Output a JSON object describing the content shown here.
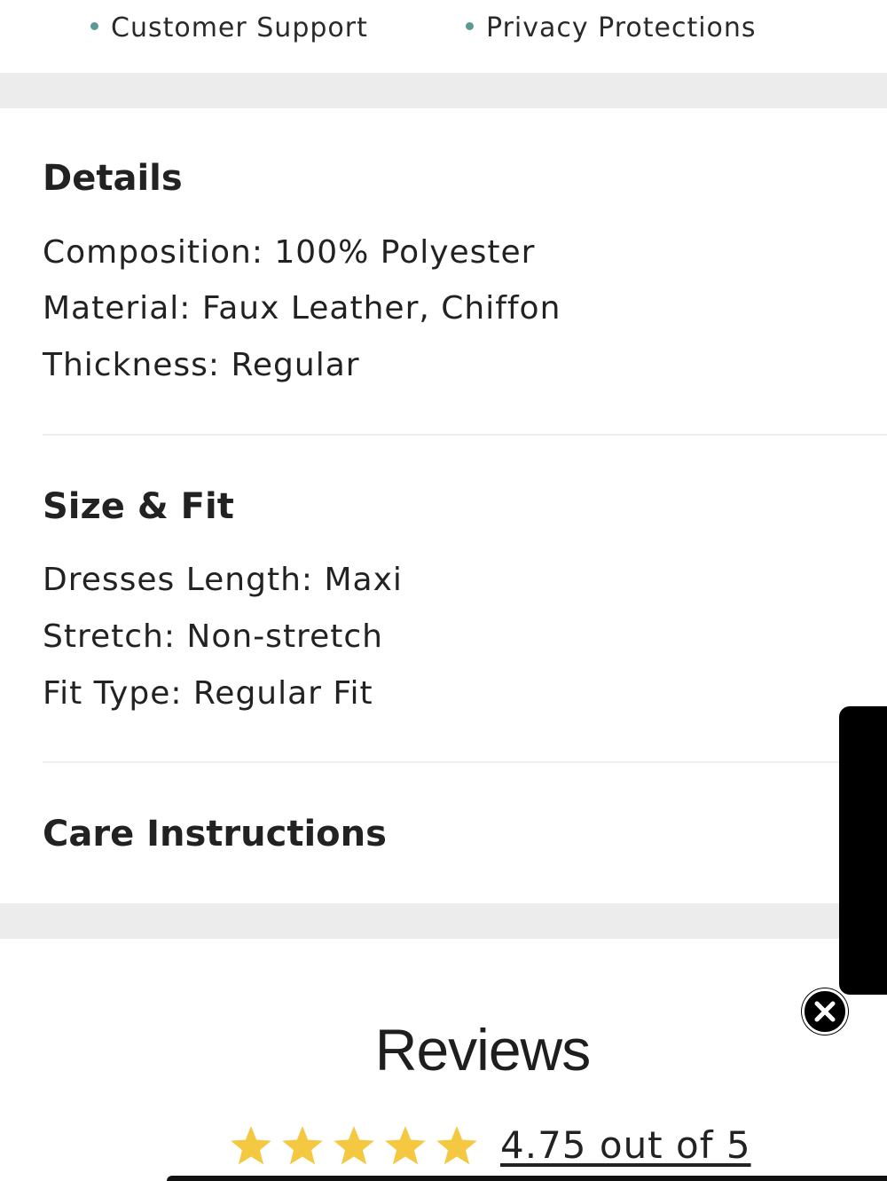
{
  "bullets": {
    "item1": "Customer Support",
    "item2": "Privacy Protections",
    "dot_color": "#5a9a95"
  },
  "details": {
    "title": "Details",
    "lines": [
      "Composition: 100% Polyester",
      "Material: Faux Leather, Chiffon",
      "Thickness: Regular"
    ]
  },
  "size_fit": {
    "title": "Size & Fit",
    "lines": [
      "Dresses Length: Maxi",
      "Stretch: Non-stretch",
      "Fit Type: Regular Fit"
    ]
  },
  "care": {
    "title": "Care Instructions"
  },
  "reviews": {
    "title": "Reviews",
    "rating_text": "4.75 out of 5",
    "rating_value": 4.75,
    "rating_max": 5,
    "star_color": "#f5c842"
  },
  "icons": {
    "close": "close-icon",
    "star": "star-icon"
  }
}
